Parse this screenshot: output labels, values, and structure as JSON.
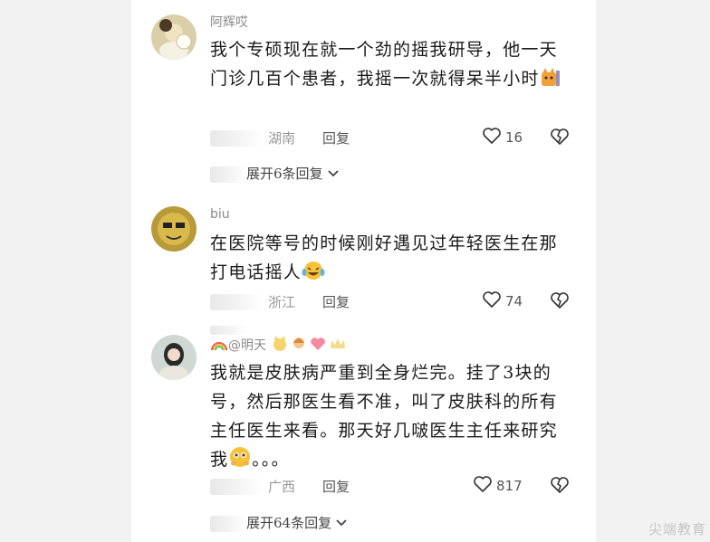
{
  "comments": [
    {
      "username": "阿辉哎",
      "text": "我个专硕现在就一个劲的摇我研导，他一天门诊几百个患者，我摇一次就得呆半小时",
      "location": "湖南",
      "reply_label": "回复",
      "like_count": "16",
      "expand_label": "展开6条回复",
      "emoji": "cat-emoji"
    },
    {
      "username": "biu",
      "text": "在医院等号的时候刚好遇见过年轻医生在那打电话摇人",
      "location": "浙江",
      "reply_label": "回复",
      "like_count": "74",
      "emoji": "laughing-crying-emoji"
    },
    {
      "username": "@明天",
      "text": "我就是皮肤病严重到全身烂完。挂了3块的号，然后那医生看不准，叫了皮肤科的所有主任医生来看。那天好几啵医生主任来研究我",
      "text_tail": "。。。",
      "location": "广西",
      "reply_label": "回复",
      "like_count": "817",
      "expand_label": "展开64条回复",
      "emoji": "pleading-emoji"
    }
  ],
  "icons": {
    "like": "heart-outline-icon",
    "dislike": "broken-heart-icon",
    "expand": "chevron-down-icon"
  },
  "watermark": "尖端教育",
  "colors": {
    "text": "#1a1a1a",
    "muted": "#999999",
    "background": "#f2f2f2",
    "panel": "#ffffff"
  }
}
